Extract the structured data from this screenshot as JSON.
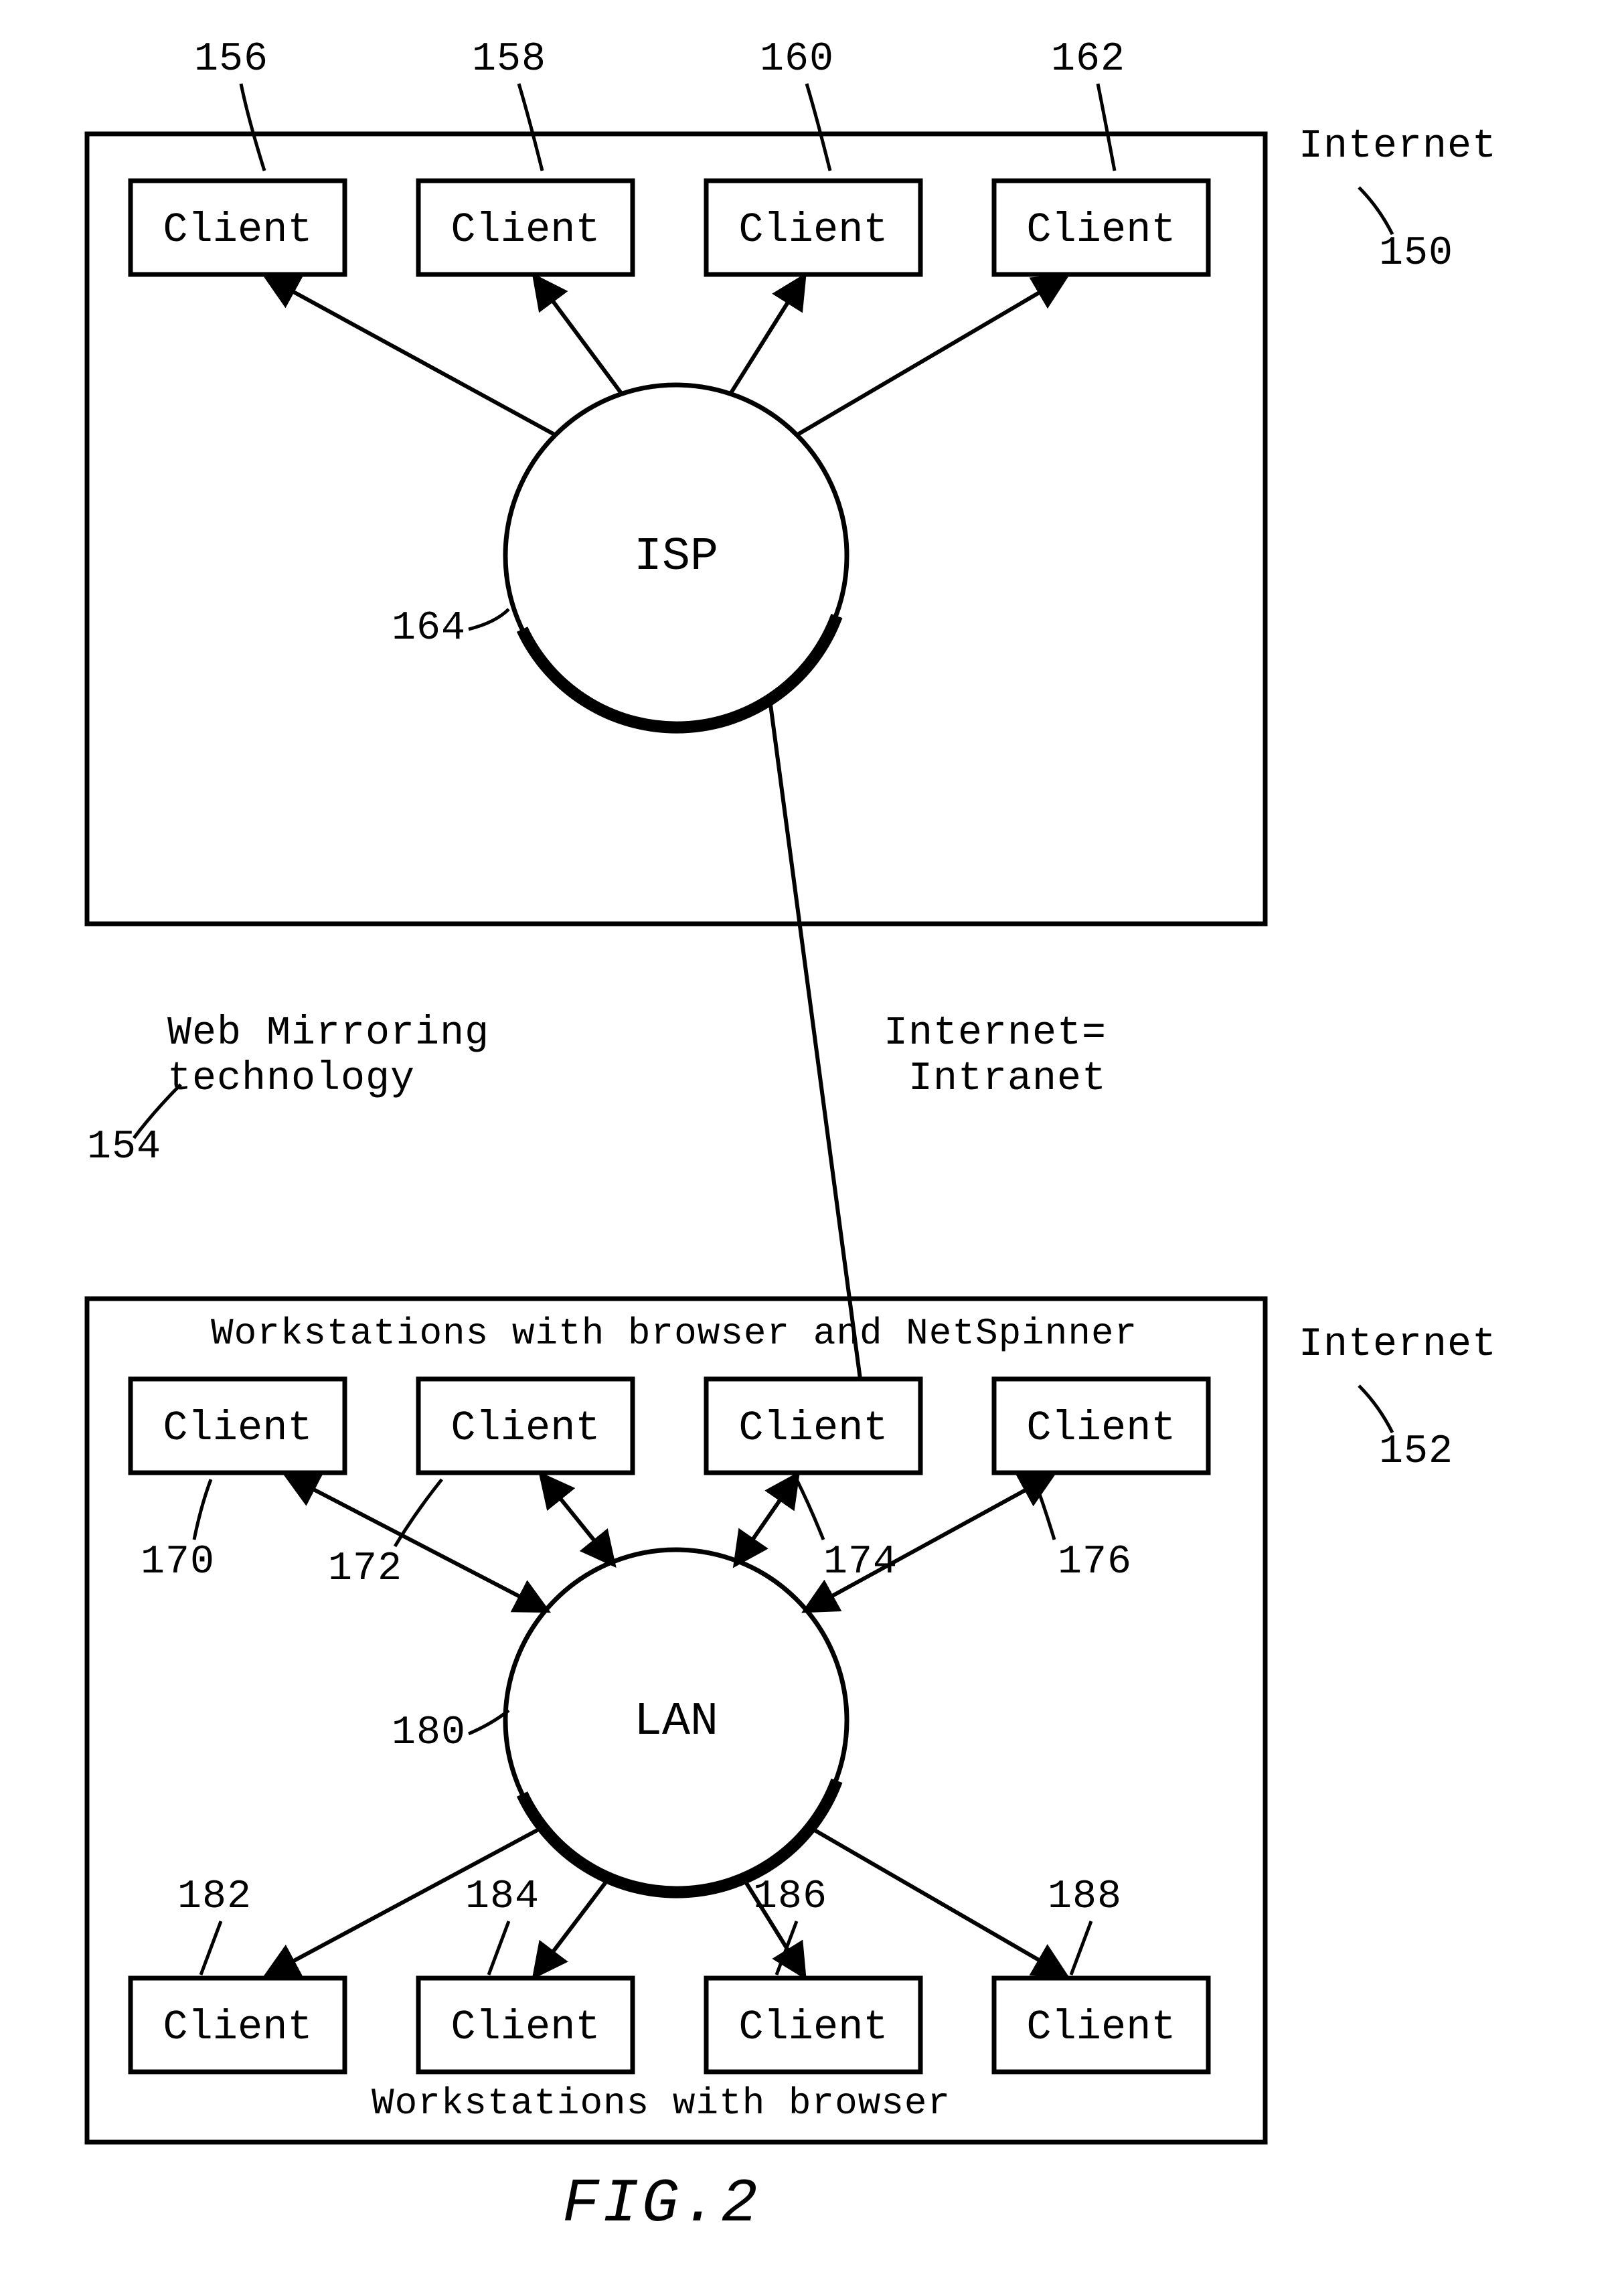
{
  "figure": {
    "caption": "FIG.2"
  },
  "upper": {
    "frame_label": "Internet",
    "frame_ref": "150",
    "hub_label": "ISP",
    "hub_ref": "164",
    "clients": [
      {
        "label": "Client",
        "ref": "156"
      },
      {
        "label": "Client",
        "ref": "158"
      },
      {
        "label": "Client",
        "ref": "160"
      },
      {
        "label": "Client",
        "ref": "162"
      }
    ]
  },
  "middle": {
    "left_label": "Web Mirroring\ntechnology",
    "left_ref": "154",
    "right_label": "Internet=\n Intranet"
  },
  "lower": {
    "frame_label": "Internet",
    "frame_ref": "152",
    "title_top": "Workstations with browser and NetSpinner",
    "title_bottom": "Workstations with browser",
    "hub_label": "LAN",
    "hub_ref": "180",
    "clients_top": [
      {
        "label": "Client",
        "ref": "170"
      },
      {
        "label": "Client",
        "ref": "172"
      },
      {
        "label": "Client",
        "ref": "174"
      },
      {
        "label": "Client",
        "ref": "176"
      }
    ],
    "clients_bottom": [
      {
        "label": "Client",
        "ref": "182"
      },
      {
        "label": "Client",
        "ref": "184"
      },
      {
        "label": "Client",
        "ref": "186"
      },
      {
        "label": "Client",
        "ref": "188"
      }
    ]
  }
}
